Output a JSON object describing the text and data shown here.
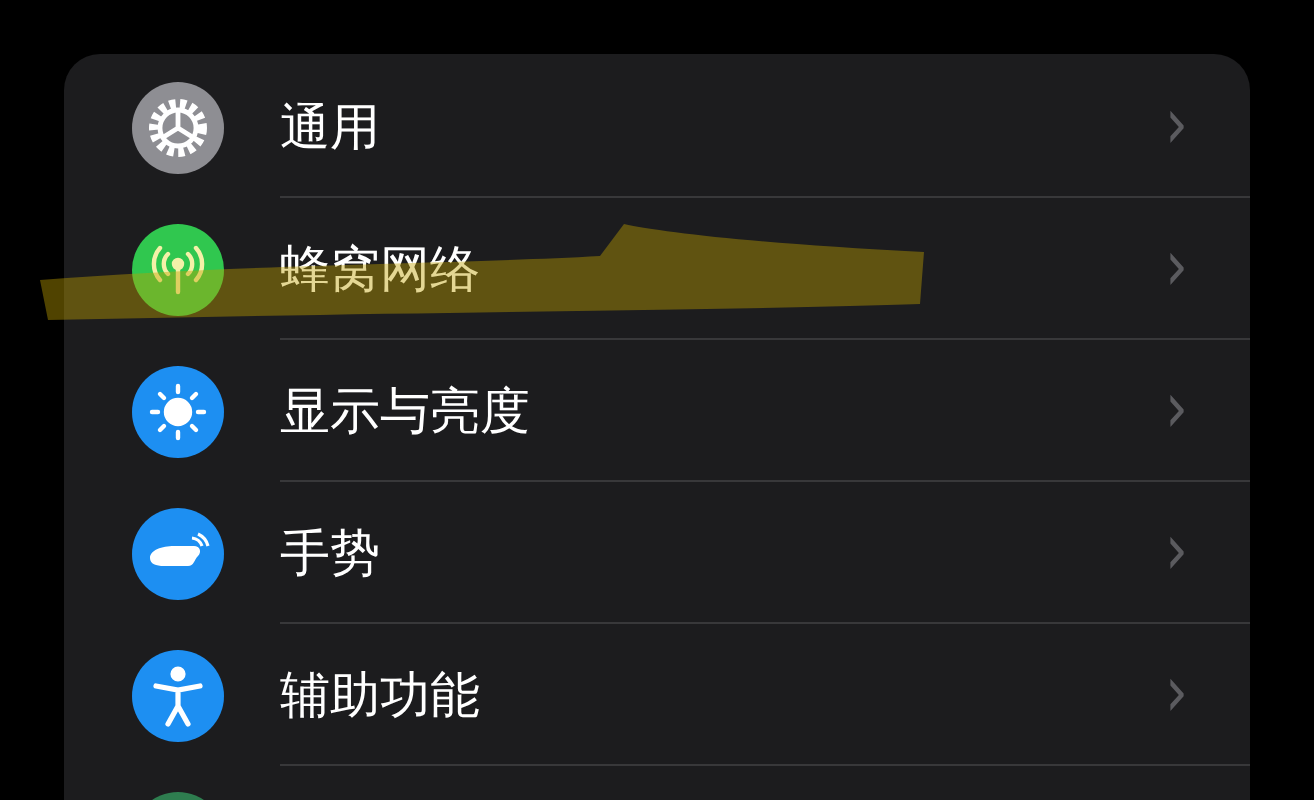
{
  "settings_list": [
    {
      "kind": "gear",
      "label": "通用",
      "chevron": "›"
    },
    {
      "kind": "antenna",
      "label": "蜂窝网络",
      "chevron": "›"
    },
    {
      "kind": "sun",
      "label": "显示与亮度",
      "chevron": "›"
    },
    {
      "kind": "hand",
      "label": "手势",
      "chevron": "›"
    },
    {
      "kind": "accessibility",
      "label": "辅助功能",
      "chevron": "›"
    },
    {
      "kind": "partial"
    }
  ],
  "annotation": {
    "kind": "highlighter"
  }
}
